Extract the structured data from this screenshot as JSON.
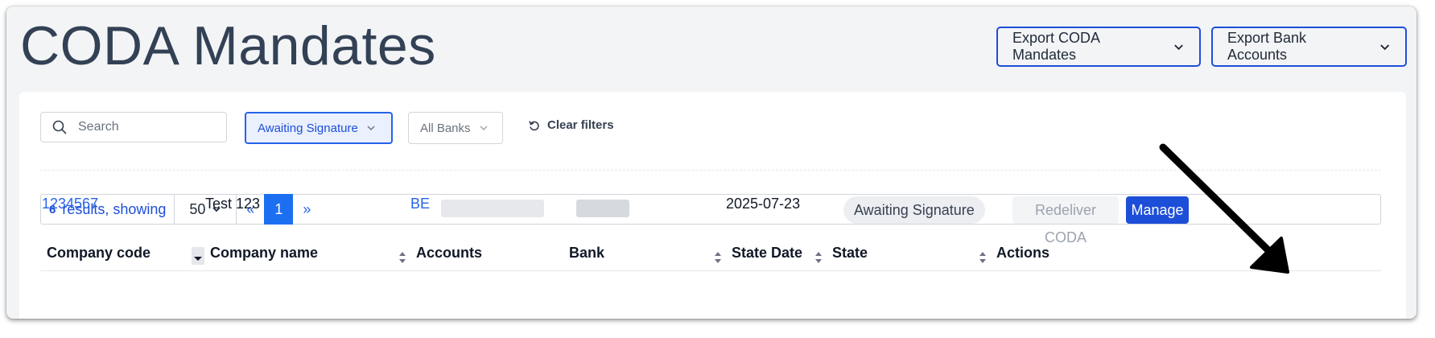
{
  "page": {
    "title": "CODA Mandates"
  },
  "header": {
    "export_mandates_label": "Export CODA Mandates",
    "export_bank_accounts_label": "Export Bank Accounts"
  },
  "filters": {
    "search_placeholder": "Search",
    "state_filter": "Awaiting Signature",
    "bank_filter": "All Banks",
    "clear_label": "Clear filters"
  },
  "pagination": {
    "count": "6",
    "results_label": "results, showing",
    "per_page": "50",
    "prev_label": "«",
    "current_page": "1",
    "next_label": "»"
  },
  "table": {
    "columns": [
      "Company code",
      "Company name",
      "Accounts",
      "Bank",
      "State Date",
      "State",
      "Actions"
    ],
    "rows": [
      {
        "company_code": "1234567",
        "company_name": "Test 123",
        "accounts_prefix": "BE",
        "state_date": "2025-07-23",
        "state": "Awaiting Signature",
        "actions": [
          "Redeliver CODA",
          "Manage"
        ]
      }
    ]
  },
  "colors": {
    "accent": "#1d4ed8",
    "link": "#2563eb",
    "page_bg": "#f3f4f6",
    "annotation_arrow": "#000000"
  }
}
